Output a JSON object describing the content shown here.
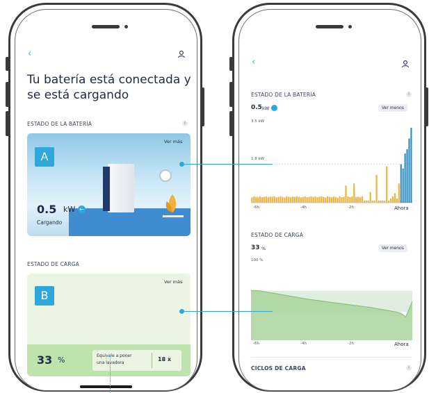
{
  "left": {
    "title_line1": "Tu batería está conectada y",
    "title_line2": "se está cargando",
    "battery_section": "ESTADO DE LA BATERÍA",
    "card_a_badge": "A",
    "card_a_vermas": "Ver más",
    "power_value": "0.5",
    "power_unit": "kW",
    "charging_label": "Cargando",
    "charge_section": "ESTADO DE CARGA",
    "card_b_badge": "B",
    "card_b_vermas": "Ver más",
    "charge_value": "33",
    "charge_unit": "%",
    "equiv_text_1": "Equivale a poner",
    "equiv_text_2": "una lavadora",
    "equiv_count": "18 x"
  },
  "right": {
    "battery_section": "ESTADO DE LA BATERÍA",
    "power_value": "0.5",
    "power_unit": "kW",
    "ver_menos_1": "Ver menos",
    "charge_section": "ESTADO DE CARGA",
    "charge_value": "33",
    "charge_unit": "%",
    "ver_menos_2": "Ver menos",
    "cycles_section": "CICLOS DE CARGA",
    "info_glyph": "i"
  },
  "icons": {
    "back": "chevron-left-icon",
    "profile": "user-icon"
  },
  "colors": {
    "accent_blue": "#2fa7dd",
    "bar_orange": "#f0b23c",
    "bar_blue": "#2b8bc0",
    "area_green": "#a9d49a",
    "card_green": "#eaf6e3"
  },
  "chart_data": [
    {
      "type": "bar",
      "title": "",
      "series": [
        {
          "name": "",
          "values": [
            0.25,
            0.3,
            0.28,
            0.27,
            0.3,
            0.26,
            0.28,
            0.3,
            0.27,
            0.29,
            0.28,
            0.3,
            0.26,
            0.28,
            0.3,
            0.27,
            0.25,
            0.3,
            0.28,
            0.26,
            0.29,
            0.27,
            0.3,
            0.28,
            0.25,
            0.27,
            0.3,
            0.26,
            0.28,
            0.3,
            0.27,
            0.29,
            0.26,
            0.28,
            0.3,
            0.27,
            0.25,
            0.3,
            0.28,
            0.26,
            0.3,
            0.27,
            0.24,
            0.3,
            0.26,
            0.28,
            0.8,
            0.3,
            0.26,
            0.3,
            0.9,
            0.27,
            0.28,
            0.26,
            0.3,
            0.1,
            0.1,
            0.1,
            0.5,
            0.1,
            0.1,
            1.3,
            0.1,
            0.1,
            0.1,
            0.1,
            1.7,
            0.1,
            0.2,
            0.3,
            0.45,
            0.2,
            0.9,
            1.8,
            1.6,
            2.3,
            2.5,
            3.0,
            3.5
          ]
        }
      ],
      "x_ticks": [
        "-6h",
        "-4h",
        "-2h",
        "Ahora"
      ],
      "y_ticks": [
        "3.5 kW",
        "1.8 kW"
      ],
      "ylim": [
        0,
        3.5
      ]
    },
    {
      "type": "area",
      "title": "",
      "x": [
        0,
        0.05,
        0.15,
        0.25,
        0.35,
        0.45,
        0.55,
        0.65,
        0.75,
        0.85,
        0.9,
        0.93,
        0.96,
        1.0
      ],
      "values": [
        70,
        70,
        66,
        62,
        58,
        55,
        52,
        49,
        46,
        42,
        40,
        38,
        33,
        55
      ],
      "x_ticks": [
        "-6h",
        "-4h",
        "-2h",
        "Ahora"
      ],
      "y_ticks": [
        "100 %"
      ],
      "ylim": [
        0,
        100
      ]
    }
  ]
}
